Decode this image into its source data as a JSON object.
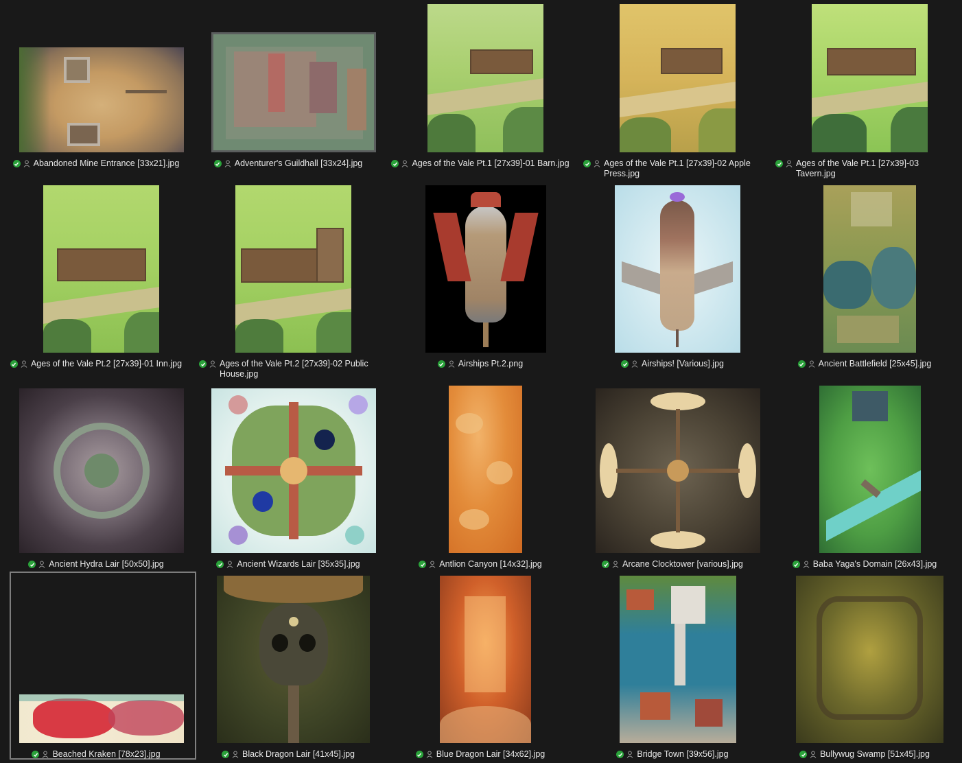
{
  "items": [
    {
      "name": "Abandoned Mine Entrance [33x21].jpg",
      "icon": "map-thumbnail"
    },
    {
      "name": "Adventurer's Guildhall [33x24].jpg",
      "icon": "map-thumbnail"
    },
    {
      "name": "Ages of the Vale Pt.1 [27x39]-01 Barn.jpg",
      "icon": "map-thumbnail"
    },
    {
      "name": "Ages of the Vale Pt.1 [27x39]-02 Apple Press.jpg",
      "icon": "map-thumbnail"
    },
    {
      "name": "Ages of the Vale Pt.1 [27x39]-03 Tavern.jpg",
      "icon": "map-thumbnail"
    },
    {
      "name": "Ages of the Vale Pt.2 [27x39]-01 Inn.jpg",
      "icon": "map-thumbnail"
    },
    {
      "name": "Ages of the Vale Pt.2 [27x39]-02 Public House.jpg",
      "icon": "map-thumbnail"
    },
    {
      "name": "Airships Pt.2.png",
      "icon": "map-thumbnail"
    },
    {
      "name": "Airships! [Various].jpg",
      "icon": "map-thumbnail"
    },
    {
      "name": "Ancient Battlefield [25x45].jpg",
      "icon": "map-thumbnail"
    },
    {
      "name": "Ancient Hydra Lair [50x50].jpg",
      "icon": "map-thumbnail"
    },
    {
      "name": "Ancient Wizards Lair [35x35].jpg",
      "icon": "map-thumbnail"
    },
    {
      "name": "Antlion Canyon [14x32].jpg",
      "icon": "map-thumbnail"
    },
    {
      "name": "Arcane Clocktower [various].jpg",
      "icon": "map-thumbnail"
    },
    {
      "name": "Baba Yaga's Domain [26x43].jpg",
      "icon": "map-thumbnail"
    },
    {
      "name": "Beached Kraken [78x23].jpg",
      "icon": "map-thumbnail"
    },
    {
      "name": "Black Dragon Lair [41x45].jpg",
      "icon": "map-thumbnail"
    },
    {
      "name": "Blue Dragon Lair [34x62].jpg",
      "icon": "map-thumbnail"
    },
    {
      "name": "Bridge Town [39x56].jpg",
      "icon": "map-thumbnail"
    },
    {
      "name": "Bullywug Swamp [51x45].jpg",
      "icon": "map-thumbnail"
    }
  ],
  "selected_index": 15,
  "status_color": "#2aa23a"
}
